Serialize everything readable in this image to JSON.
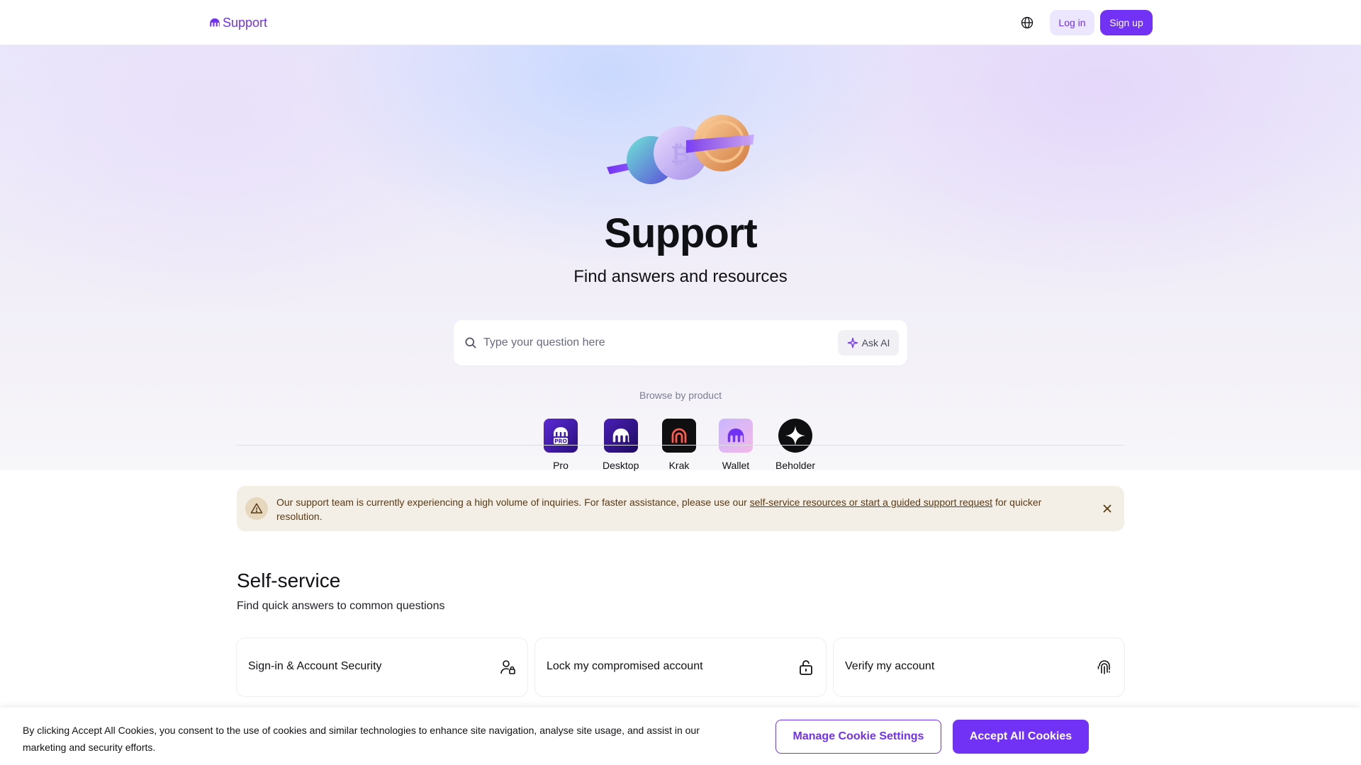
{
  "header": {
    "logo_text": "Support",
    "login_label": "Log in",
    "signup_label": "Sign up"
  },
  "hero": {
    "title": "Support",
    "subtitle": "Find answers and resources",
    "search_placeholder": "Type your question here",
    "ask_ai_label": "Ask AI",
    "browse_label": "Browse by product",
    "products": [
      {
        "label": "Pro",
        "icon": "kraken-pro-icon"
      },
      {
        "label": "Desktop",
        "icon": "kraken-desktop-icon"
      },
      {
        "label": "Krak",
        "icon": "krak-icon"
      },
      {
        "label": "Wallet",
        "icon": "kraken-wallet-icon"
      },
      {
        "label": "Beholder",
        "icon": "beholder-icon"
      }
    ]
  },
  "banner": {
    "text_before": "Our support team is currently experiencing a high volume of inquiries. For faster assistance, please use our ",
    "link_text": "self-service resources or start a guided support request",
    "text_after": " for quicker resolution."
  },
  "self_service": {
    "title": "Self-service",
    "subtitle": "Find quick answers to common questions",
    "cards": [
      {
        "title": "Sign-in & Account Security",
        "icon": "user-lock-icon"
      },
      {
        "title": "Lock my compromised account",
        "icon": "unlock-icon"
      },
      {
        "title": "Verify my account",
        "icon": "fingerprint-icon"
      }
    ]
  },
  "cookie": {
    "text": "By clicking Accept All Cookies, you consent to the use of cookies and similar technologies to enhance site navigation, analyse site usage, and assist in our marketing and security efforts.",
    "manage_label": "Manage Cookie Settings",
    "accept_label": "Accept All Cookies"
  },
  "colors": {
    "brand": "#7132f5",
    "banner_bg": "#f4efe6",
    "banner_text": "#5a3a10"
  }
}
